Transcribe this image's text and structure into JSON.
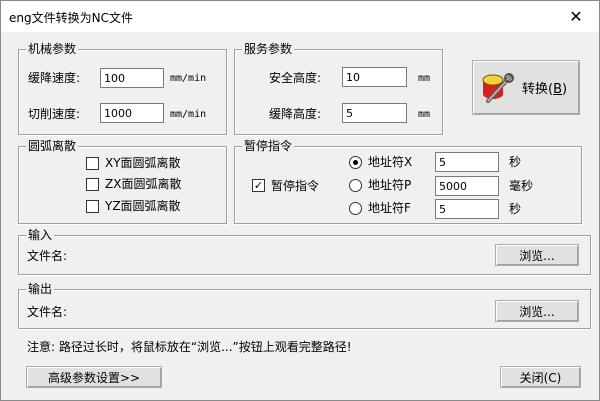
{
  "window": {
    "title": "eng文件转换为NC文件",
    "close_glyph": "✕"
  },
  "mech": {
    "title": "机械参数",
    "descent_label": "缓降速度:",
    "descent_value": "100",
    "descent_unit": "mm/min",
    "cut_label": "切削速度:",
    "cut_value": "1000",
    "cut_unit": "mm/min"
  },
  "service": {
    "title": "服务参数",
    "safe_label": "安全高度:",
    "safe_value": "10",
    "safe_unit": "mm",
    "descent_label": "缓降高度:",
    "descent_value": "5",
    "descent_unit": "mm"
  },
  "convert_button": {
    "label": "转换(",
    "accel": "B",
    "suffix": ")",
    "icon": "tools-icon"
  },
  "arc": {
    "title": "圆弧离散",
    "options": [
      "XY面圆弧离散",
      "ZX面圆弧离散",
      "YZ面圆弧离散"
    ]
  },
  "pause": {
    "title": "暂停指令",
    "check_label": "暂停指令",
    "check_mark": "✓",
    "options": [
      {
        "label": "地址符X",
        "value": "5",
        "unit": "秒",
        "selected": true
      },
      {
        "label": "地址符P",
        "value": "5000",
        "unit": "毫秒",
        "selected": false
      },
      {
        "label": "地址符F",
        "value": "5",
        "unit": "秒",
        "selected": false
      }
    ]
  },
  "input": {
    "title": "输入",
    "file_label": "文件名:",
    "browse": "浏览..."
  },
  "output": {
    "title": "输出",
    "file_label": "文件名:",
    "browse": "浏览..."
  },
  "note": "注意: 路径过长时，将鼠标放在“浏览...”按钮上观看完整路径!",
  "advanced_button": "高级参数设置>>",
  "close_button": "关闭(C)"
}
